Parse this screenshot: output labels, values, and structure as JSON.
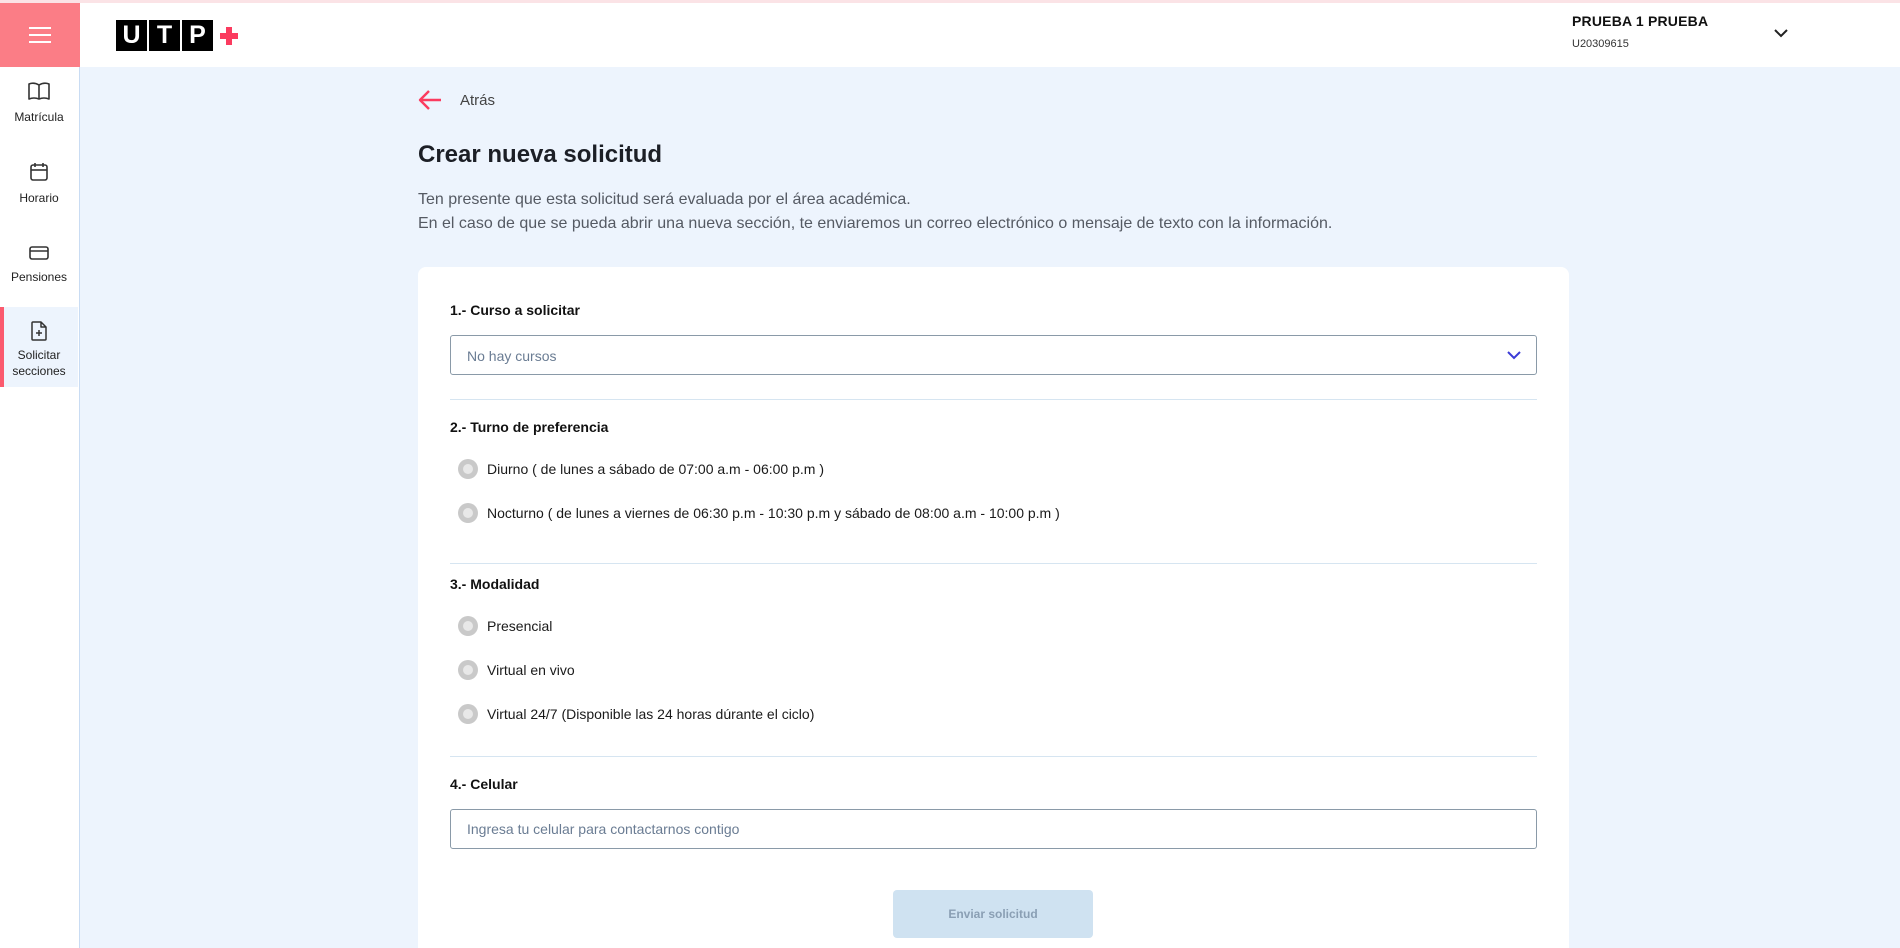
{
  "colors": {
    "brand_pink": "#fb7d86",
    "accent_red": "#fb5a6e",
    "background": "#edf4fd",
    "disabled_button": "#cfe2f1"
  },
  "header": {
    "logo_letters": [
      "U",
      "T",
      "P"
    ],
    "logo_plus_icon": "plus-icon",
    "user_name": "PRUEBA 1 PRUEBA",
    "user_code": "U20309615",
    "user_menu_icon": "chevron-down-icon"
  },
  "sidebar": {
    "menu_icon": "hamburger-icon",
    "items": [
      {
        "label": "Matrícula",
        "icon": "book-icon"
      },
      {
        "label": "Horario",
        "icon": "calendar-icon"
      },
      {
        "label": "Pensiones",
        "icon": "credit-card-icon"
      },
      {
        "label": "Solicitar secciones",
        "icon": "file-plus-icon",
        "active": true
      }
    ]
  },
  "main": {
    "back_label": "Atrás",
    "title": "Crear nueva solicitud",
    "description_line1": "Ten presente que esta solicitud será evaluada por el área académica.",
    "description_line2": "En el caso de que se pueda abrir una nueva sección, te enviaremos un correo electrónico o mensaje de texto con la información."
  },
  "form": {
    "course": {
      "label": "1.- Curso a solicitar",
      "selected": "No hay cursos"
    },
    "shift": {
      "label": "2.- Turno de preferencia",
      "options": [
        "Diurno ( de lunes a sábado de 07:00 a.m - 06:00 p.m )",
        "Nocturno ( de lunes a viernes de 06:30 p.m - 10:30 p.m y sábado de 08:00 a.m - 10:00 p.m )"
      ]
    },
    "modality": {
      "label": "3.- Modalidad",
      "options": [
        "Presencial",
        "Virtual en vivo",
        "Virtual 24/7 (Disponible las 24 horas dúrante el ciclo)"
      ]
    },
    "phone": {
      "label": "4.- Celular",
      "value": "",
      "placeholder": "Ingresa tu celular para contactarnos contigo"
    },
    "submit_label": "Enviar solicitud"
  }
}
